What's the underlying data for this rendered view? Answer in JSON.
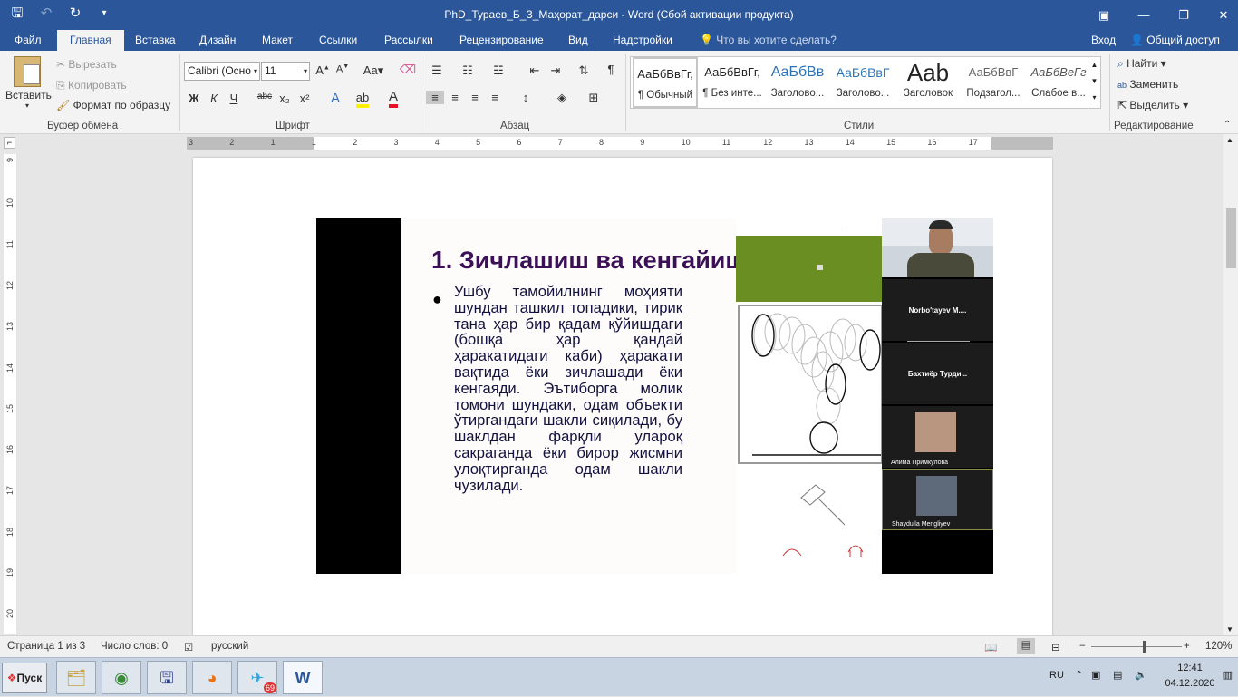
{
  "window": {
    "title": "PhD_Тураев_Б_З_Маҳорат_дарси - Word (Сбой активации продукта)"
  },
  "tabs": [
    "Файл",
    "Главная",
    "Вставка",
    "Дизайн",
    "Макет",
    "Ссылки",
    "Рассылки",
    "Рецензирование",
    "Вид",
    "Надстройки"
  ],
  "tell_me": "Что вы хотите сделать?",
  "sign_in": "Вход",
  "share": "Общий доступ",
  "clipboard": {
    "paste": "Вставить",
    "cut": "Вырезать",
    "copy": "Копировать",
    "format_painter": "Формат по образцу",
    "group": "Буфер обмена"
  },
  "font": {
    "name": "Calibri (Осно",
    "size": "11",
    "group": "Шрифт",
    "bold": "Ж",
    "italic": "К",
    "underline": "Ч",
    "strike": "abc",
    "sub": "x₂",
    "sup": "x²",
    "case": "Аа"
  },
  "paragraph": {
    "group": "Абзац"
  },
  "styles": {
    "group": "Стили",
    "items": [
      {
        "sample": "АаБбВвГг,",
        "name": "¶ Обычный"
      },
      {
        "sample": "АаБбВвГг,",
        "name": "¶ Без инте..."
      },
      {
        "sample": "АаБбВв",
        "name": "Заголово..."
      },
      {
        "sample": "АаБбВвГ",
        "name": "Заголово..."
      },
      {
        "sample": "Aab",
        "name": "Заголовок"
      },
      {
        "sample": "АаБбВвГ",
        "name": "Подзагол..."
      },
      {
        "sample": "АаБбВеГг",
        "name": "Слабое в..."
      }
    ]
  },
  "editing": {
    "find": "Найти",
    "replace": "Заменить",
    "select": "Выделить",
    "group": "Редактирование"
  },
  "ruler": {
    "h_ticks": [
      "3",
      "2",
      "1",
      "1",
      "2",
      "3",
      "4",
      "5",
      "6",
      "7",
      "8",
      "9",
      "10",
      "11",
      "12",
      "13",
      "14",
      "15",
      "16",
      "17"
    ],
    "v_ticks": [
      "9",
      "10",
      "11",
      "12",
      "13",
      "14",
      "15",
      "16",
      "17",
      "18",
      "19",
      "20"
    ]
  },
  "slide": {
    "number": "1.",
    "title": "Зичлашиш ва кенгайиш",
    "bullet": "●",
    "text": "Ушбу тамойилнинг моҳияти шундан ташкил топадики, тирик тана ҳар бир қадам қўйишдаги (бошқа ҳар қандай ҳаракатидаги каби) ҳаракати вақтида ёки зичлашади ёки кенгаяди. Эътиборга молик томони шундаки, одам объекти ўтиргандаги шакли сиқилади, бу шаклдан фарқли улароқ сакраганда ёки бирор жисмни улоқтирганда одам шакли чузилади."
  },
  "participants": [
    {
      "name": "Norbo'tayev  M...."
    },
    {
      "name": "Бахтиёр   Турди..."
    },
    {
      "name": "Алима Примкулова"
    },
    {
      "name": "Shaydulla Mengliyev"
    }
  ],
  "status": {
    "page": "Страница 1 из 3",
    "words": "Число слов: 0",
    "language": "русский",
    "zoom": "120%",
    "zoom_level": 0.6
  },
  "taskbar": {
    "start": "Пуск",
    "telegram_badge": "69",
    "lang": "RU",
    "time": "12:41",
    "date": "04.12.2020"
  }
}
